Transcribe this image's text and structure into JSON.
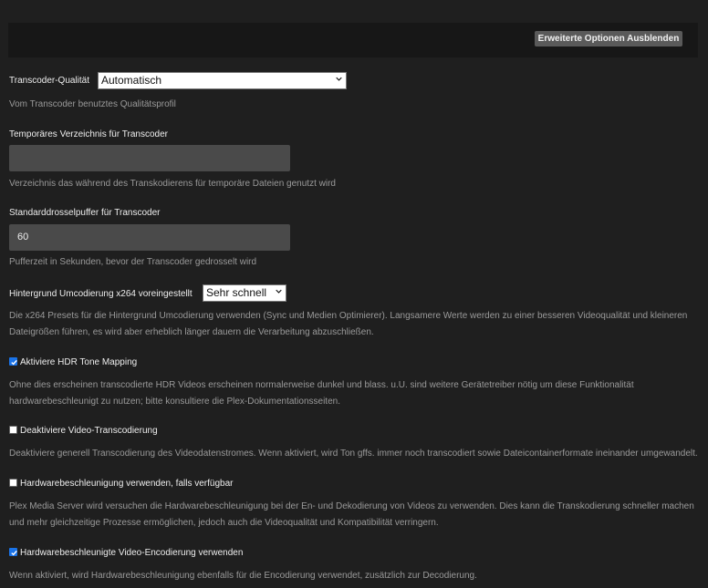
{
  "header": {
    "advanced_button_label": "Erweiterte Optionen Ausblenden"
  },
  "transcoder_quality": {
    "label": "Transcoder-Qualität",
    "selected": "Automatisch",
    "help": "Vom Transcoder benutztes Qualitätsprofil"
  },
  "temp_dir": {
    "label": "Temporäres Verzeichnis für Transcoder",
    "value": "",
    "help": "Verzeichnis das während des Transkodierens für temporäre Dateien genutzt wird"
  },
  "throttle_buffer": {
    "label": "Standarddrosselpuffer für Transcoder",
    "value": "60",
    "help": "Pufferzeit in Sekunden, bevor der Transcoder gedrosselt wird"
  },
  "x264_preset": {
    "label": "Hintergrund Umcodierung x264 voreingestellt",
    "selected": "Sehr schnell",
    "help": "Die x264 Presets für die Hintergrund Umcodierung verwenden (Sync und Medien Optimierer). Langsamere Werte werden zu einer besseren Videoqualität und kleineren Dateigrößen führen, es wird aber erheblich länger dauern die Verarbeitung abzuschließen."
  },
  "hdr_tone_mapping": {
    "label": "Aktiviere HDR Tone Mapping",
    "checked": true,
    "help": "Ohne dies erscheinen transcodierte HDR Videos erscheinen normalerweise dunkel und blass. u.U. sind weitere Gerätetreiber nötig um diese Funktionalität hardwarebeschleunigt zu nutzen; bitte konsultiere die Plex-Dokumentationsseiten."
  },
  "disable_video_transcoding": {
    "label": "Deaktiviere Video-Transcodierung",
    "checked": false,
    "help": "Deaktiviere generell Transcodierung des Videodatenstromes. Wenn aktiviert, wird Ton gffs. immer noch transcodiert sowie Dateicontainerformate ineinander umgewandelt."
  },
  "hw_acceleration": {
    "label": "Hardwarebeschleunigung verwenden, falls verfügbar",
    "checked": false,
    "help": "Plex Media Server wird versuchen die Hardwarebeschleunigung bei der En- und Dekodierung von Videos zu verwenden. Dies kann die Transkodierung schneller machen und mehr gleichzeitige Prozesse ermöglichen, jedoch auch die Videoqualität und Kompatibilität verringern."
  },
  "hw_encoding": {
    "label": "Hardwarebeschleunigte Video-Encodierung verwenden",
    "checked": true,
    "help": "Wenn aktiviert, wird Hardwarebeschleunigung ebenfalls für die Encodierung verwendet, zusätzlich zur Decodierung."
  },
  "colors": {
    "background": "#1f1f1f",
    "checkbox_accent": "#1a73e8"
  }
}
